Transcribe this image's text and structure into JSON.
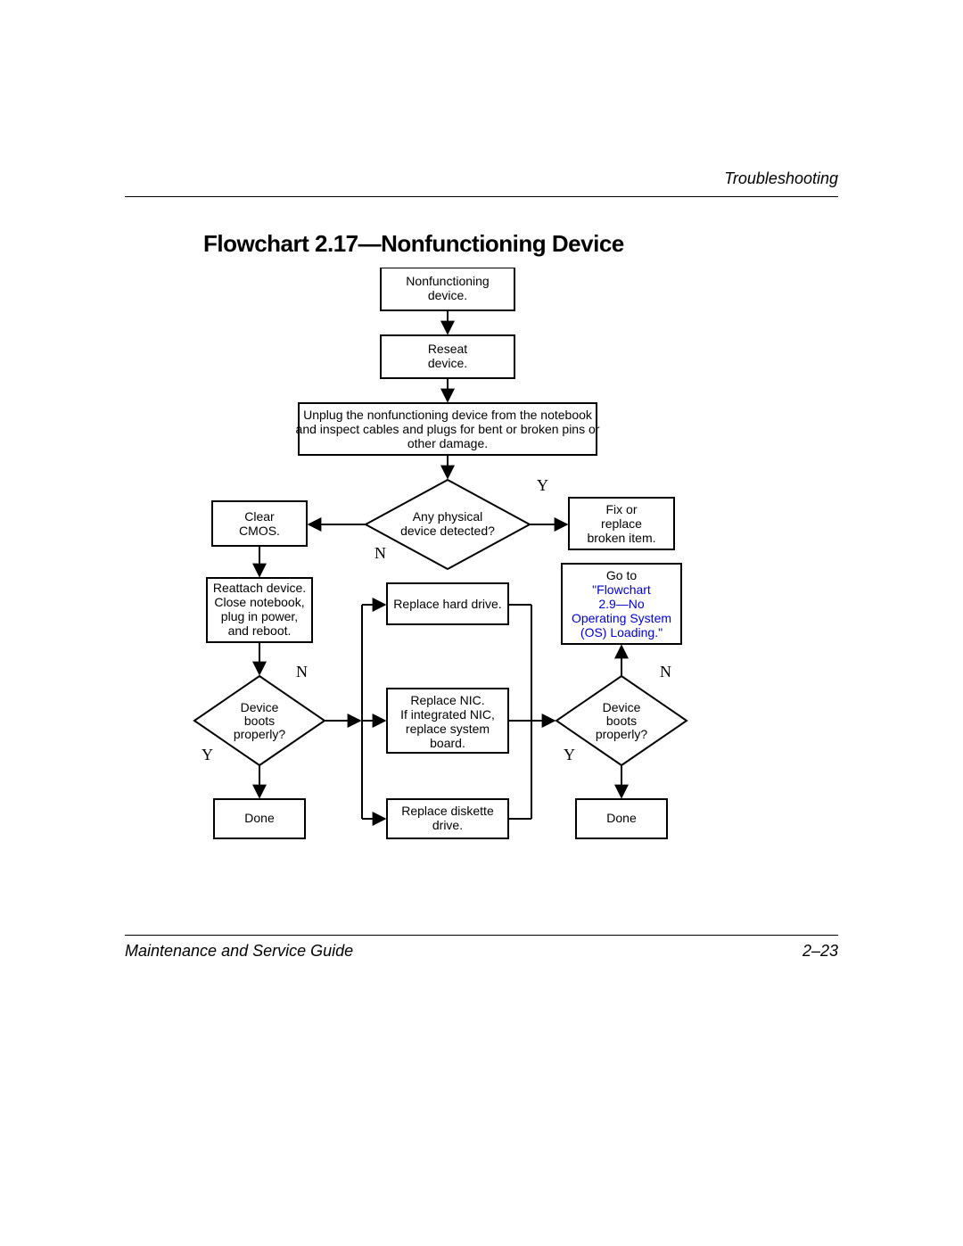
{
  "header": {
    "section": "Troubleshooting"
  },
  "title": "Flowchart 2.17—Nonfunctioning Device",
  "footer": {
    "left": "Maintenance and Service Guide",
    "right": "2–23"
  },
  "labels": {
    "yes": "Y",
    "no": "N"
  },
  "nodes": {
    "start": {
      "l1": "Nonfunctioning",
      "l2": "device."
    },
    "reseat": {
      "l1": "Reseat",
      "l2": "device."
    },
    "unplug": {
      "l1": "Unplug the nonfunctioning device from the notebook",
      "l2": "and inspect cables and plugs for bent or broken pins or",
      "l3": "other damage."
    },
    "physical": {
      "l1": "Any physical",
      "l2": "device detected?"
    },
    "clear_cmos": {
      "l1": "Clear",
      "l2": "CMOS."
    },
    "fix": {
      "l1": "Fix or",
      "l2": "replace",
      "l3": "broken item."
    },
    "reattach": {
      "l1": "Reattach device.",
      "l2": "Close notebook,",
      "l3": "plug in power,",
      "l4": "and reboot."
    },
    "replace_hd": {
      "l1": "Replace hard drive."
    },
    "replace_nic": {
      "l1": "Replace NIC.",
      "l2": "If integrated NIC,",
      "l3": "replace system",
      "l4": "board."
    },
    "replace_diskette": {
      "l1": "Replace diskette",
      "l2": "drive."
    },
    "boots_left": {
      "l1": "Device",
      "l2": "boots",
      "l3": "properly?"
    },
    "boots_right": {
      "l1": "Device",
      "l2": "boots",
      "l3": "properly?"
    },
    "done_left": "Done",
    "done_right": "Done",
    "goto": {
      "l1": "Go to",
      "l2": "\"Flowchart",
      "l3": "2.9—No",
      "l4": "Operating System",
      "l5": "(OS) Loading.\""
    }
  }
}
